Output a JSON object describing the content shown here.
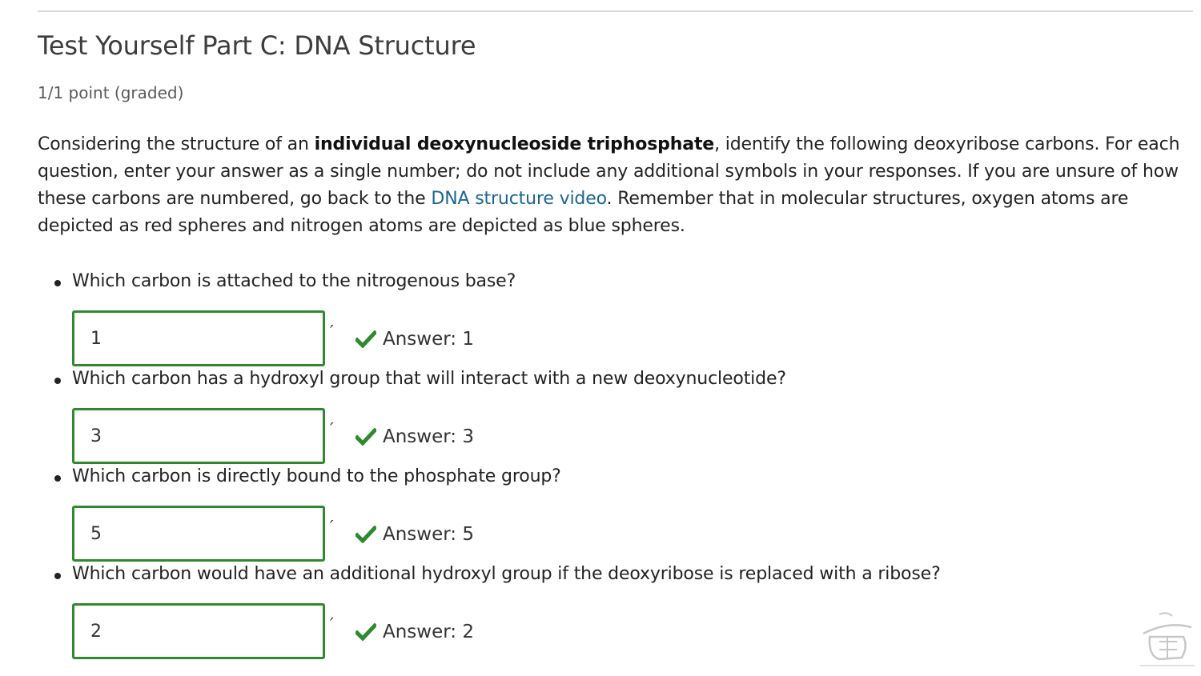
{
  "problem": {
    "title": "Test Yourself Part C: DNA Structure",
    "progress": "1/1 point (graded)",
    "intro": {
      "part1": "Considering the structure of an ",
      "bold": "individual deoxynucleoside triphosphate",
      "part2": ", identify the following deoxyribose carbons. For each question, enter your answer as a single number; do not include any additional symbols in your responses. If you are unsure of how these carbons are numbered, go back to the ",
      "link_text": "DNA structure video",
      "part3": ". Remember that in molecular structures, oxygen atoms are depicted as red spheres and nitrogen atoms are depicted as blue spheres."
    }
  },
  "questions": [
    {
      "prompt": "Which carbon is attached to the nitrogenous base?",
      "value": "1",
      "suffix": "′",
      "answer": "Answer: 1",
      "status_icon": "check-icon",
      "status_color": "#2f8a2f"
    },
    {
      "prompt": "Which carbon has a hydroxyl group that will interact with a new deoxynucleotide?",
      "value": "3",
      "suffix": "′",
      "answer": "Answer: 3",
      "status_icon": "check-icon",
      "status_color": "#2f8a2f"
    },
    {
      "prompt": "Which carbon is directly bound to the phosphate group?",
      "value": "5",
      "suffix": "′",
      "answer": "Answer: 5",
      "status_icon": "check-icon",
      "status_color": "#2f8a2f"
    },
    {
      "prompt": "Which carbon would have an additional hydroxyl group if the deoxyribose is replaced with a ribose?",
      "value": "2",
      "suffix": "′",
      "answer": "Answer: 2",
      "status_icon": "check-icon",
      "status_color": "#2f8a2f"
    }
  ],
  "colors": {
    "link": "#1c6593",
    "correct": "#2f8a2f"
  }
}
